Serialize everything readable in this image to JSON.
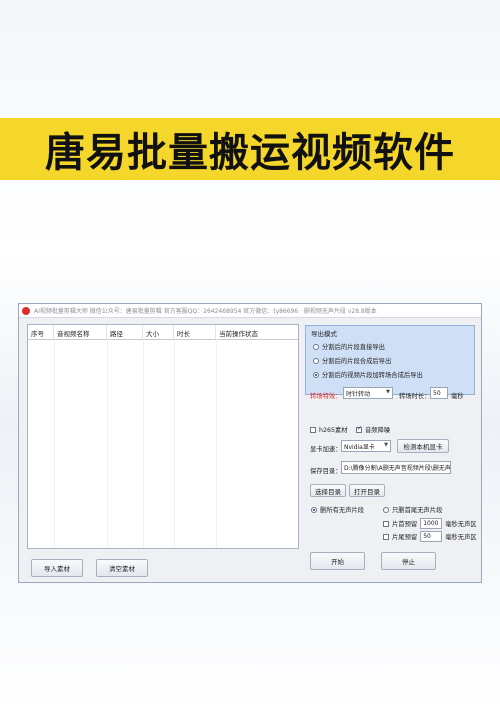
{
  "banner": {
    "title": "唐易批量搬运视频软件"
  },
  "app": {
    "title": "AI视频批量剪辑大师  微信公众号：唐易批量剪辑  官方客服QQ：2642468954  官方微信：ty86696 · 删视频无声片段  v28.8版本"
  },
  "table": {
    "headers": [
      "序号",
      "音视频名称",
      "路径",
      "大小",
      "时长",
      "当前操作状态"
    ]
  },
  "buttons": {
    "import": "导入素材",
    "clear": "清空素材",
    "select_dir": "选择目录",
    "open_dir": "打开目录",
    "start": "开始",
    "stop": "停止",
    "detect_gpu": "检测本机显卡"
  },
  "export": {
    "title": "导出模式",
    "options": [
      "分割后的片段直接导出",
      "分割后的片段合成后导出",
      "分割后的视频片段加转场合成后导出"
    ],
    "selected_index": 2,
    "transition_label": "转场特效：",
    "transition_value": "时针转动",
    "transition_duration_label": "转场时长：",
    "transition_duration_value": "50",
    "transition_duration_unit": "毫秒"
  },
  "options": {
    "h265_label": "h265素材",
    "h265_checked": false,
    "denoise_label": "音频降噪",
    "denoise_checked": true,
    "gpu_label": "显卡加速：",
    "gpu_value": "Nvidia显卡",
    "save_label": "保存目录：",
    "save_path": "D:\\腾像分割\\A删无声音视频片段\\删无声"
  },
  "silent": {
    "delete_all_label": "删所有无声片段",
    "delete_all_selected": true,
    "head_tail_label": "只删首尾无声片段",
    "head_tail_selected": false,
    "head_keep_label": "片首预留",
    "head_keep_value": "1000",
    "head_keep_unit": "毫秒无声区",
    "tail_keep_label": "片尾预留",
    "tail_keep_value": "50",
    "tail_keep_unit": "毫秒无声区"
  },
  "colors": {
    "banner": "#f5d62a",
    "accent_red": "#e02b2b",
    "panel_blue": "#cfe0f6"
  }
}
